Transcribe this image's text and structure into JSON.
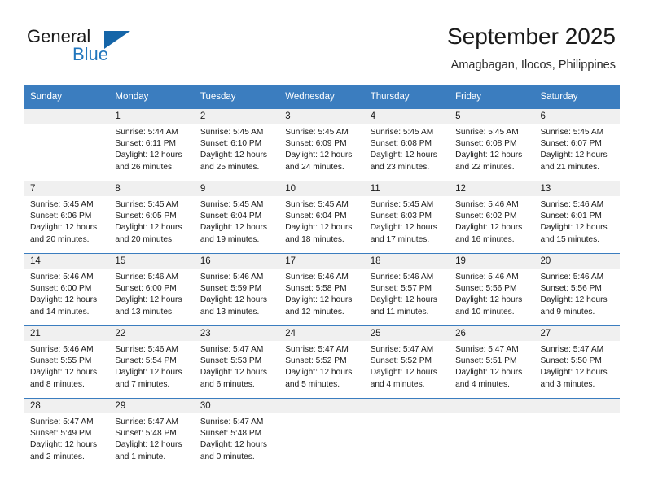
{
  "brand": {
    "name_part1": "General",
    "name_part2": "Blue",
    "triangle_icon": "triangle-icon",
    "accent_color": "#1565a8",
    "blue_text_color": "#2176bd"
  },
  "header": {
    "month_title": "September 2025",
    "location": "Amagbagan, Ilocos, Philippines"
  },
  "theme": {
    "header_row_color": "#3b7dbf",
    "daynum_bar_color": "#f0f0f0",
    "separator_color": "#3b7dbf",
    "text_color": "#1a1a1a"
  },
  "calendar": {
    "weekday_headers": [
      "Sunday",
      "Monday",
      "Tuesday",
      "Wednesday",
      "Thursday",
      "Friday",
      "Saturday"
    ],
    "weeks": [
      [
        {
          "day": "",
          "sunrise": "",
          "sunset": "",
          "daylight_line1": "",
          "daylight_line2": "",
          "blank": true
        },
        {
          "day": "1",
          "sunrise": "Sunrise: 5:44 AM",
          "sunset": "Sunset: 6:11 PM",
          "daylight_line1": "Daylight: 12 hours",
          "daylight_line2": "and 26 minutes."
        },
        {
          "day": "2",
          "sunrise": "Sunrise: 5:45 AM",
          "sunset": "Sunset: 6:10 PM",
          "daylight_line1": "Daylight: 12 hours",
          "daylight_line2": "and 25 minutes."
        },
        {
          "day": "3",
          "sunrise": "Sunrise: 5:45 AM",
          "sunset": "Sunset: 6:09 PM",
          "daylight_line1": "Daylight: 12 hours",
          "daylight_line2": "and 24 minutes."
        },
        {
          "day": "4",
          "sunrise": "Sunrise: 5:45 AM",
          "sunset": "Sunset: 6:08 PM",
          "daylight_line1": "Daylight: 12 hours",
          "daylight_line2": "and 23 minutes."
        },
        {
          "day": "5",
          "sunrise": "Sunrise: 5:45 AM",
          "sunset": "Sunset: 6:08 PM",
          "daylight_line1": "Daylight: 12 hours",
          "daylight_line2": "and 22 minutes."
        },
        {
          "day": "6",
          "sunrise": "Sunrise: 5:45 AM",
          "sunset": "Sunset: 6:07 PM",
          "daylight_line1": "Daylight: 12 hours",
          "daylight_line2": "and 21 minutes."
        }
      ],
      [
        {
          "day": "7",
          "sunrise": "Sunrise: 5:45 AM",
          "sunset": "Sunset: 6:06 PM",
          "daylight_line1": "Daylight: 12 hours",
          "daylight_line2": "and 20 minutes."
        },
        {
          "day": "8",
          "sunrise": "Sunrise: 5:45 AM",
          "sunset": "Sunset: 6:05 PM",
          "daylight_line1": "Daylight: 12 hours",
          "daylight_line2": "and 20 minutes."
        },
        {
          "day": "9",
          "sunrise": "Sunrise: 5:45 AM",
          "sunset": "Sunset: 6:04 PM",
          "daylight_line1": "Daylight: 12 hours",
          "daylight_line2": "and 19 minutes."
        },
        {
          "day": "10",
          "sunrise": "Sunrise: 5:45 AM",
          "sunset": "Sunset: 6:04 PM",
          "daylight_line1": "Daylight: 12 hours",
          "daylight_line2": "and 18 minutes."
        },
        {
          "day": "11",
          "sunrise": "Sunrise: 5:45 AM",
          "sunset": "Sunset: 6:03 PM",
          "daylight_line1": "Daylight: 12 hours",
          "daylight_line2": "and 17 minutes."
        },
        {
          "day": "12",
          "sunrise": "Sunrise: 5:46 AM",
          "sunset": "Sunset: 6:02 PM",
          "daylight_line1": "Daylight: 12 hours",
          "daylight_line2": "and 16 minutes."
        },
        {
          "day": "13",
          "sunrise": "Sunrise: 5:46 AM",
          "sunset": "Sunset: 6:01 PM",
          "daylight_line1": "Daylight: 12 hours",
          "daylight_line2": "and 15 minutes."
        }
      ],
      [
        {
          "day": "14",
          "sunrise": "Sunrise: 5:46 AM",
          "sunset": "Sunset: 6:00 PM",
          "daylight_line1": "Daylight: 12 hours",
          "daylight_line2": "and 14 minutes."
        },
        {
          "day": "15",
          "sunrise": "Sunrise: 5:46 AM",
          "sunset": "Sunset: 6:00 PM",
          "daylight_line1": "Daylight: 12 hours",
          "daylight_line2": "and 13 minutes."
        },
        {
          "day": "16",
          "sunrise": "Sunrise: 5:46 AM",
          "sunset": "Sunset: 5:59 PM",
          "daylight_line1": "Daylight: 12 hours",
          "daylight_line2": "and 13 minutes."
        },
        {
          "day": "17",
          "sunrise": "Sunrise: 5:46 AM",
          "sunset": "Sunset: 5:58 PM",
          "daylight_line1": "Daylight: 12 hours",
          "daylight_line2": "and 12 minutes."
        },
        {
          "day": "18",
          "sunrise": "Sunrise: 5:46 AM",
          "sunset": "Sunset: 5:57 PM",
          "daylight_line1": "Daylight: 12 hours",
          "daylight_line2": "and 11 minutes."
        },
        {
          "day": "19",
          "sunrise": "Sunrise: 5:46 AM",
          "sunset": "Sunset: 5:56 PM",
          "daylight_line1": "Daylight: 12 hours",
          "daylight_line2": "and 10 minutes."
        },
        {
          "day": "20",
          "sunrise": "Sunrise: 5:46 AM",
          "sunset": "Sunset: 5:56 PM",
          "daylight_line1": "Daylight: 12 hours",
          "daylight_line2": "and 9 minutes."
        }
      ],
      [
        {
          "day": "21",
          "sunrise": "Sunrise: 5:46 AM",
          "sunset": "Sunset: 5:55 PM",
          "daylight_line1": "Daylight: 12 hours",
          "daylight_line2": "and 8 minutes."
        },
        {
          "day": "22",
          "sunrise": "Sunrise: 5:46 AM",
          "sunset": "Sunset: 5:54 PM",
          "daylight_line1": "Daylight: 12 hours",
          "daylight_line2": "and 7 minutes."
        },
        {
          "day": "23",
          "sunrise": "Sunrise: 5:47 AM",
          "sunset": "Sunset: 5:53 PM",
          "daylight_line1": "Daylight: 12 hours",
          "daylight_line2": "and 6 minutes."
        },
        {
          "day": "24",
          "sunrise": "Sunrise: 5:47 AM",
          "sunset": "Sunset: 5:52 PM",
          "daylight_line1": "Daylight: 12 hours",
          "daylight_line2": "and 5 minutes."
        },
        {
          "day": "25",
          "sunrise": "Sunrise: 5:47 AM",
          "sunset": "Sunset: 5:52 PM",
          "daylight_line1": "Daylight: 12 hours",
          "daylight_line2": "and 4 minutes."
        },
        {
          "day": "26",
          "sunrise": "Sunrise: 5:47 AM",
          "sunset": "Sunset: 5:51 PM",
          "daylight_line1": "Daylight: 12 hours",
          "daylight_line2": "and 4 minutes."
        },
        {
          "day": "27",
          "sunrise": "Sunrise: 5:47 AM",
          "sunset": "Sunset: 5:50 PM",
          "daylight_line1": "Daylight: 12 hours",
          "daylight_line2": "and 3 minutes."
        }
      ],
      [
        {
          "day": "28",
          "sunrise": "Sunrise: 5:47 AM",
          "sunset": "Sunset: 5:49 PM",
          "daylight_line1": "Daylight: 12 hours",
          "daylight_line2": "and 2 minutes."
        },
        {
          "day": "29",
          "sunrise": "Sunrise: 5:47 AM",
          "sunset": "Sunset: 5:48 PM",
          "daylight_line1": "Daylight: 12 hours",
          "daylight_line2": "and 1 minute."
        },
        {
          "day": "30",
          "sunrise": "Sunrise: 5:47 AM",
          "sunset": "Sunset: 5:48 PM",
          "daylight_line1": "Daylight: 12 hours",
          "daylight_line2": "and 0 minutes."
        },
        {
          "day": "",
          "sunrise": "",
          "sunset": "",
          "daylight_line1": "",
          "daylight_line2": "",
          "blank": true
        },
        {
          "day": "",
          "sunrise": "",
          "sunset": "",
          "daylight_line1": "",
          "daylight_line2": "",
          "blank": true
        },
        {
          "day": "",
          "sunrise": "",
          "sunset": "",
          "daylight_line1": "",
          "daylight_line2": "",
          "blank": true
        },
        {
          "day": "",
          "sunrise": "",
          "sunset": "",
          "daylight_line1": "",
          "daylight_line2": "",
          "blank": true
        }
      ]
    ]
  }
}
